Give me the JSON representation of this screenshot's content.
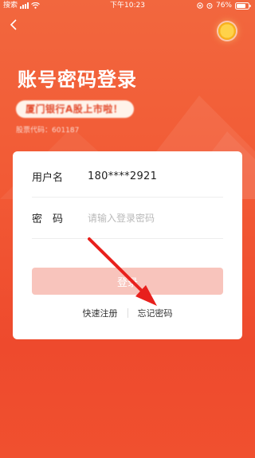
{
  "status_bar": {
    "carrier": "搜索",
    "time": "下午10:23",
    "battery": "76%"
  },
  "header": {
    "title": "账号密码登录",
    "banner": "厦门银行A股上市啦！",
    "stock_code": "股票代码：601187"
  },
  "form": {
    "username_label": "用户名",
    "username_value": "180****2921",
    "password_label": "密　码",
    "password_placeholder": "请输入登录密码",
    "login_label": "登录"
  },
  "links": {
    "register": "快速注册",
    "forgot": "忘记密码"
  },
  "colors": {
    "background": "#f25a35",
    "button_disabled": "#f8c4bc",
    "annotation_arrow": "#e8201c"
  },
  "icons": [
    "back-icon",
    "coin-icon",
    "signal-icon",
    "wifi-icon",
    "battery-icon"
  ]
}
